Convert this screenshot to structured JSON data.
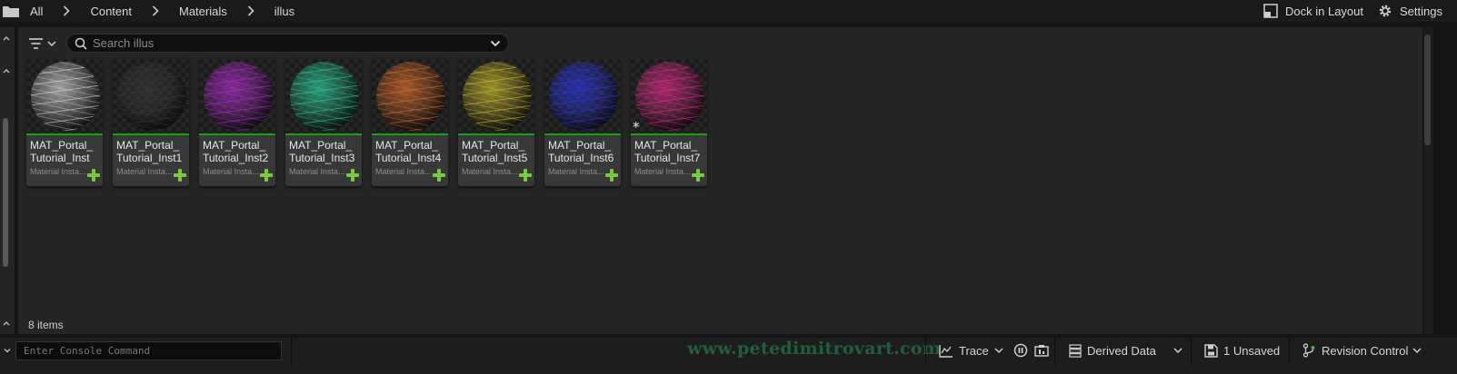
{
  "breadcrumb": {
    "items": [
      "All",
      "Content",
      "Materials",
      "illus"
    ]
  },
  "toolbar": {
    "dock_label": "Dock in Layout",
    "settings_label": "Settings"
  },
  "search": {
    "placeholder": "Search illus",
    "value": ""
  },
  "assets": [
    {
      "name": "MAT_Portal_\nTutorial_Inst",
      "type": "Material Insta...",
      "color": "#e0e0e0"
    },
    {
      "name": "MAT_Portal_\nTutorial_Inst1",
      "type": "Material Insta...",
      "color": "#3a3a3a"
    },
    {
      "name": "MAT_Portal_\nTutorial_Inst2",
      "type": "Material Insta...",
      "color": "#b82ed8"
    },
    {
      "name": "MAT_Portal_\nTutorial_Inst3",
      "type": "Material Insta...",
      "color": "#2ed8a2"
    },
    {
      "name": "MAT_Portal_\nTutorial_Inst4",
      "type": "Material Insta...",
      "color": "#e8742e"
    },
    {
      "name": "MAT_Portal_\nTutorial_Inst5",
      "type": "Material Insta...",
      "color": "#d8c82e"
    },
    {
      "name": "MAT_Portal_\nTutorial_Inst6",
      "type": "Material Insta...",
      "color": "#2e38e8"
    },
    {
      "name": "MAT_Portal_\nTutorial_Inst7",
      "type": "Material Insta...",
      "color": "#e82e8e",
      "unsaved": true,
      "unsaved_mark": "*"
    }
  ],
  "item_count": "8 items",
  "statusbar": {
    "console_placeholder": "Enter Console Command",
    "watermark": "www.petedimitrovart.com",
    "trace_label": "Trace",
    "derived_data_label": "Derived Data",
    "unsaved_label": "1 Unsaved",
    "revision_label": "Revision Control"
  },
  "colors": {
    "accent_green": "#16a316",
    "plus_green": "#7ac943"
  }
}
